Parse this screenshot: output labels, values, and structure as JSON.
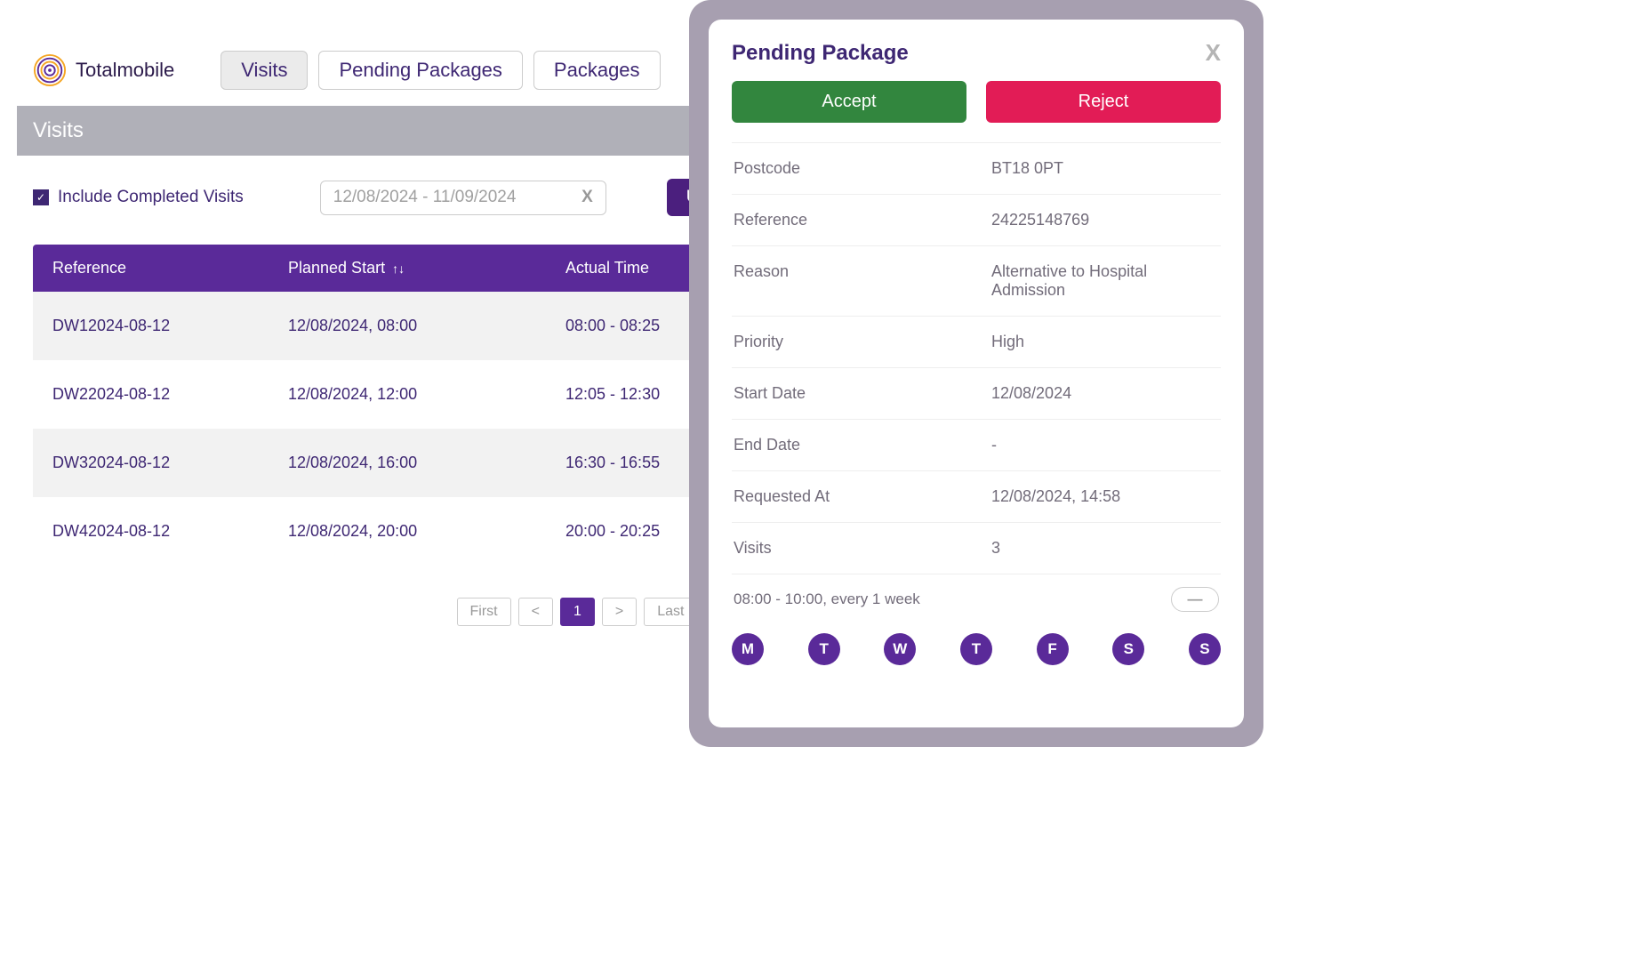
{
  "header": {
    "brand": "Totalmobile",
    "tabs": [
      "Visits",
      "Pending Packages",
      "Packages"
    ],
    "active_tab": 0
  },
  "page": {
    "title": "Visits",
    "include_completed_label": "Include Completed Visits",
    "date_range": "12/08/2024 - 11/09/2024",
    "upload_label": "Upload"
  },
  "table": {
    "columns": [
      "Reference",
      "Planned Start",
      "Actual Time"
    ],
    "rows": [
      {
        "ref": "DW12024-08-12",
        "planned": "12/08/2024, 08:00",
        "actual": "08:00 - 08:25"
      },
      {
        "ref": "DW22024-08-12",
        "planned": "12/08/2024, 12:00",
        "actual": "12:05 - 12:30"
      },
      {
        "ref": "DW32024-08-12",
        "planned": "12/08/2024, 16:00",
        "actual": "16:30 - 16:55"
      },
      {
        "ref": "DW42024-08-12",
        "planned": "12/08/2024, 20:00",
        "actual": "20:00 - 20:25"
      }
    ]
  },
  "pagination": {
    "first": "First",
    "prev": "<",
    "current": "1",
    "next": ">",
    "last": "Last"
  },
  "panel": {
    "title": "Pending Package",
    "accept": "Accept",
    "reject": "Reject",
    "details": [
      {
        "label": "Postcode",
        "value": "BT18 0PT"
      },
      {
        "label": "Reference",
        "value": "24225148769"
      },
      {
        "label": "Reason",
        "value": "Alternative to Hospital Admission"
      },
      {
        "label": "Priority",
        "value": "High"
      },
      {
        "label": "Start Date",
        "value": "12/08/2024"
      },
      {
        "label": "End Date",
        "value": "-"
      },
      {
        "label": "Requested At",
        "value": "12/08/2024, 14:58"
      },
      {
        "label": "Visits",
        "value": "3"
      }
    ],
    "schedule_text": "08:00 - 10:00, every 1 week",
    "toggle": "—",
    "days": [
      "M",
      "T",
      "W",
      "T",
      "F",
      "S",
      "S"
    ]
  }
}
